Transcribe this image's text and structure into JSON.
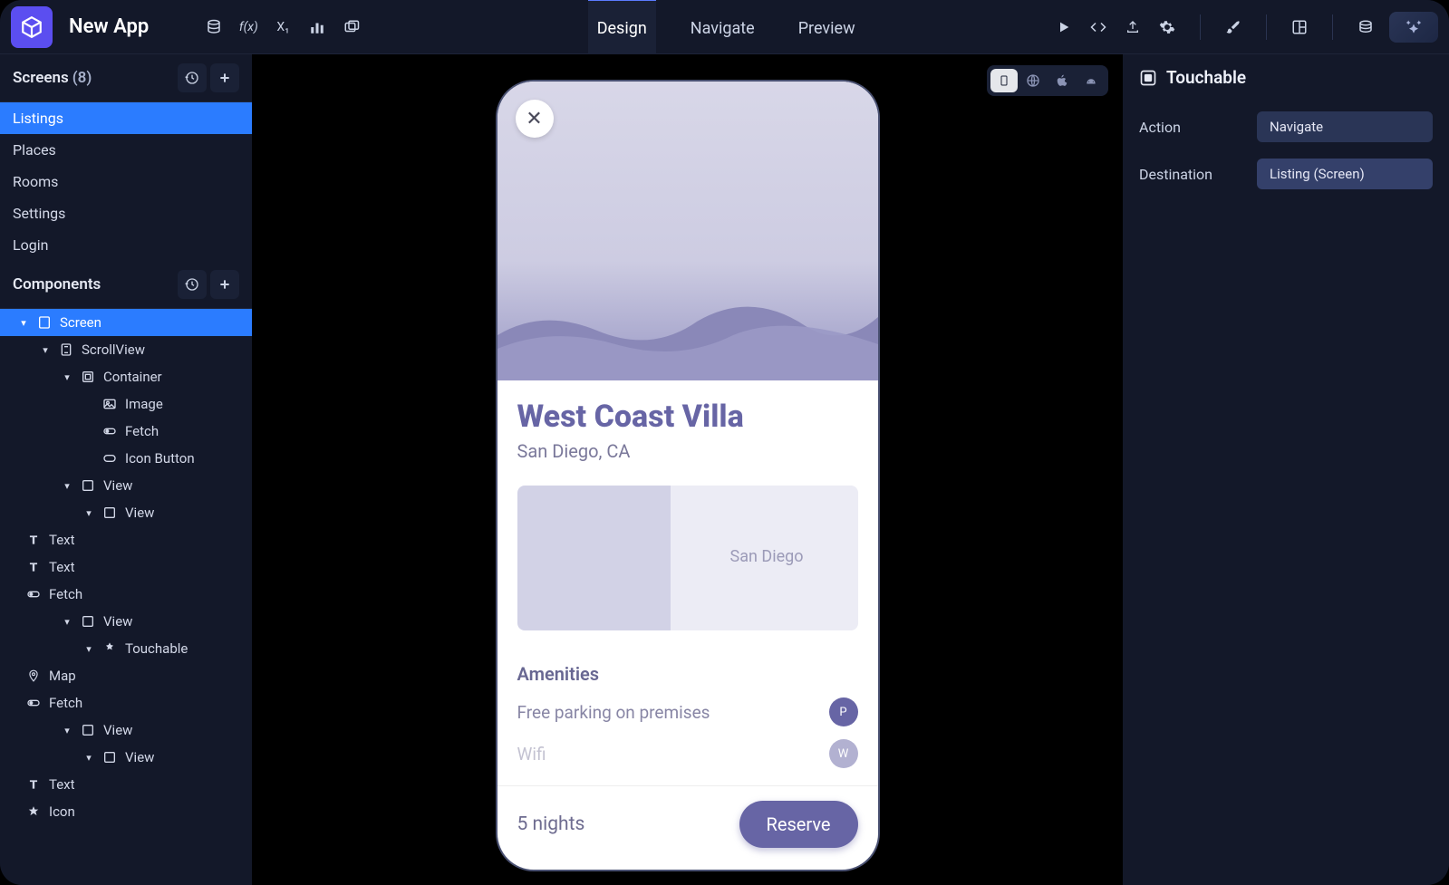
{
  "header": {
    "appTitle": "New App",
    "tabs": {
      "design": "Design",
      "navigate": "Navigate",
      "preview": "Preview"
    }
  },
  "screensPanel": {
    "title": "Screens",
    "count": "(8)",
    "items": [
      "Listings",
      "Places",
      "Rooms",
      "Settings",
      "Login"
    ],
    "activeIndex": 0
  },
  "componentsPanel": {
    "title": "Components",
    "tree": [
      {
        "label": "Screen",
        "depth": 1,
        "icon": "screen",
        "arrow": "▾",
        "active": true
      },
      {
        "label": "ScrollView",
        "depth": 2,
        "icon": "scroll",
        "arrow": "▾"
      },
      {
        "label": "Container",
        "depth": 3,
        "icon": "container",
        "arrow": "▾"
      },
      {
        "label": "Image",
        "depth": 4,
        "icon": "image",
        "arrow": ""
      },
      {
        "label": "Fetch",
        "depth": 4,
        "icon": "fetch",
        "arrow": ""
      },
      {
        "label": "Icon Button",
        "depth": 4,
        "icon": "iconbtn",
        "arrow": ""
      },
      {
        "label": "View",
        "depth": 3,
        "icon": "view",
        "arrow": "▾"
      },
      {
        "label": "View",
        "depth": 4,
        "icon": "view",
        "arrow": "▾"
      },
      {
        "label": "Text",
        "depth": 5,
        "icon": "text",
        "arrow": ""
      },
      {
        "label": "Text",
        "depth": 5,
        "icon": "text",
        "arrow": ""
      },
      {
        "label": "Fetch",
        "depth": 5,
        "icon": "fetch",
        "arrow": ""
      },
      {
        "label": "View",
        "depth": 3,
        "icon": "view",
        "arrow": "▾"
      },
      {
        "label": "Touchable",
        "depth": 4,
        "icon": "touch",
        "arrow": "▾"
      },
      {
        "label": "Map",
        "depth": 5,
        "icon": "map",
        "arrow": ""
      },
      {
        "label": "Fetch",
        "depth": 5,
        "icon": "fetch",
        "arrow": ""
      },
      {
        "label": "View",
        "depth": 3,
        "icon": "view",
        "arrow": "▾"
      },
      {
        "label": "View",
        "depth": 4,
        "icon": "view",
        "arrow": "▾"
      },
      {
        "label": "Text",
        "depth": 5,
        "icon": "text",
        "arrow": ""
      },
      {
        "label": "Icon",
        "depth": 5,
        "icon": "icon",
        "arrow": ""
      }
    ]
  },
  "preview": {
    "title": "West Coast Villa",
    "subtitle": "San Diego, CA",
    "mapLabel": "San Diego",
    "amenitiesTitle": "Amenities",
    "amenities": [
      {
        "label": "Free parking on premises",
        "badge": "P"
      },
      {
        "label": "Wifi",
        "badge": "W"
      }
    ],
    "nights": "5 nights",
    "reserve": "Reserve"
  },
  "inspector": {
    "title": "Touchable",
    "rows": [
      {
        "label": "Action",
        "value": "Navigate",
        "kind": "select"
      },
      {
        "label": "Destination",
        "value": "Listing (Screen)",
        "kind": "chip"
      }
    ]
  }
}
